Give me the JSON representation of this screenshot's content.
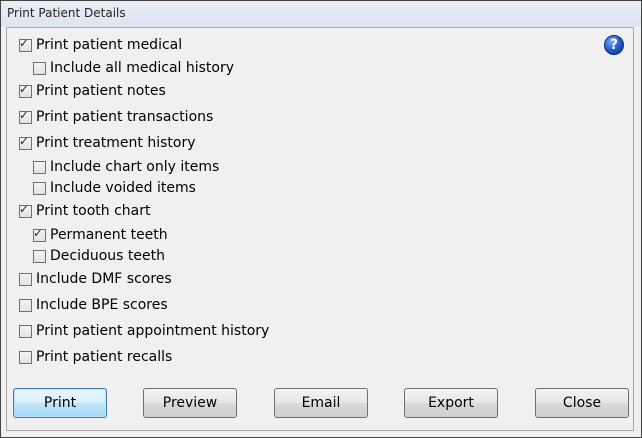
{
  "window": {
    "title": "Print Patient Details",
    "help_glyph": "?"
  },
  "options": [
    {
      "id": "print-patient-medical",
      "label": "Print patient medical",
      "checked": true
    },
    {
      "id": "include-all-medical-history",
      "label": "Include all medical history",
      "checked": false
    },
    {
      "id": "print-patient-notes",
      "label": "Print patient notes",
      "checked": true
    },
    {
      "id": "print-patient-transactions",
      "label": "Print patient transactions",
      "checked": true
    },
    {
      "id": "print-treatment-history",
      "label": "Print treatment history",
      "checked": true
    },
    {
      "id": "include-chart-only-items",
      "label": "Include chart only items",
      "checked": false
    },
    {
      "id": "include-voided-items",
      "label": "Include voided items",
      "checked": false
    },
    {
      "id": "print-tooth-chart",
      "label": "Print tooth chart",
      "checked": true
    },
    {
      "id": "permanent-teeth",
      "label": "Permanent teeth",
      "checked": true
    },
    {
      "id": "deciduous-teeth",
      "label": "Deciduous teeth",
      "checked": false
    },
    {
      "id": "include-dmf-scores",
      "label": "Include DMF scores",
      "checked": false
    },
    {
      "id": "include-bpe-scores",
      "label": "Include BPE scores",
      "checked": false
    },
    {
      "id": "print-patient-appointment-history",
      "label": "Print patient appointment history",
      "checked": false
    },
    {
      "id": "print-patient-recalls",
      "label": "Print patient recalls",
      "checked": false
    }
  ],
  "buttons": {
    "print": "Print",
    "preview": "Preview",
    "email": "Email",
    "export": "Export",
    "close": "Close"
  }
}
